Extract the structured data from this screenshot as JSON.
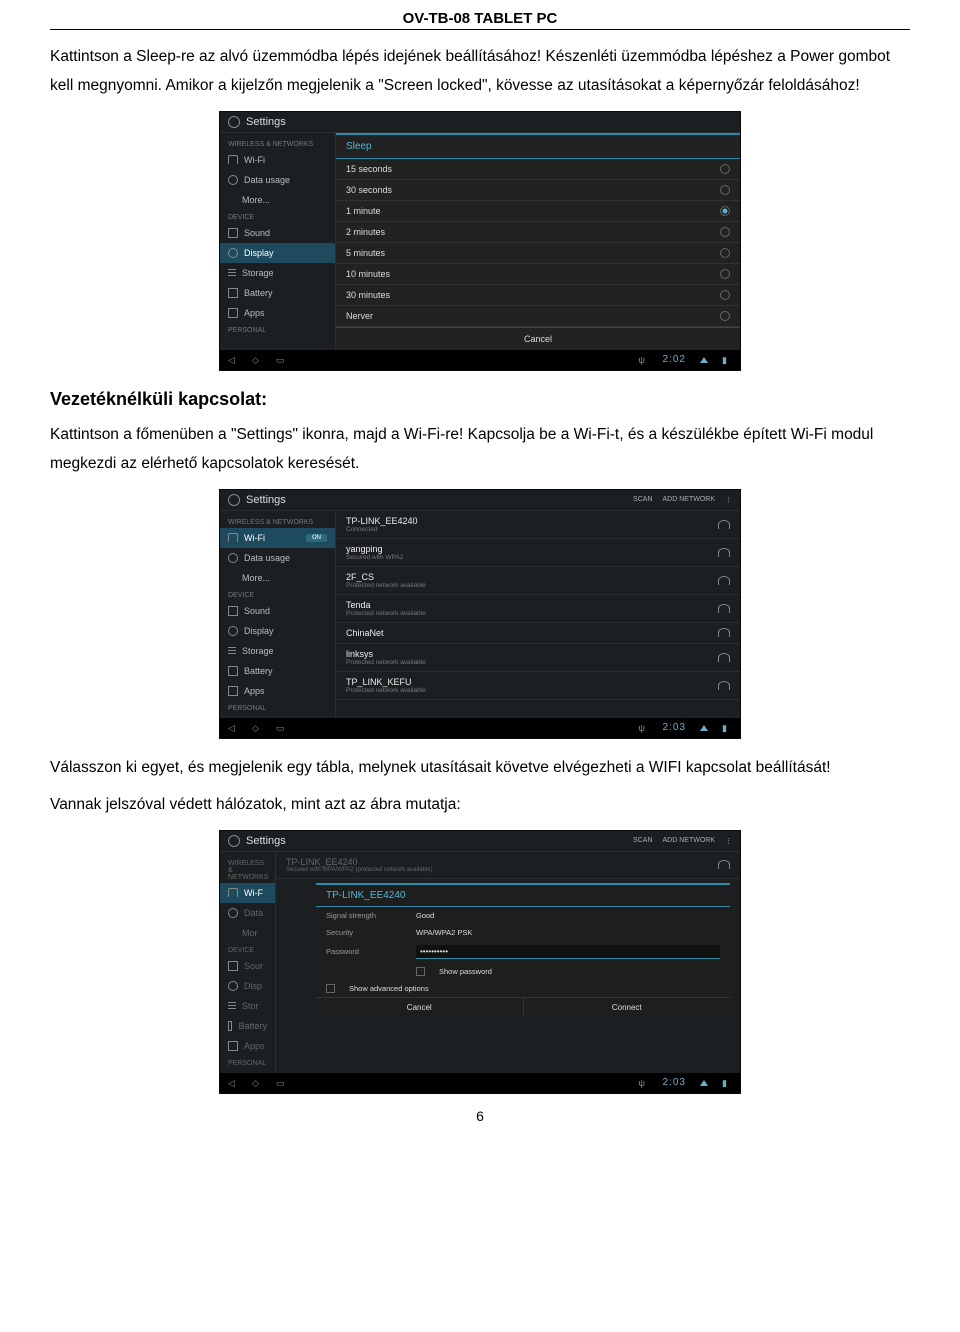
{
  "doc": {
    "header": "OV-TB-08 TABLET PC",
    "para1": "Kattintson a Sleep-re az alvó üzemmódba lépés idejének beállításához! Készenléti üzemmódba lépéshez a Power gombot kell megnyomni. Amikor a kijelzőn megjelenik a \"Screen locked\", kövesse az utasításokat a képernyőzár feloldásához!",
    "section_title": "Vezetéknélküli kapcsolat:",
    "para2": "Kattintson a főmenüben a \"Settings\" ikonra, majd a Wi-Fi-re! Kapcsolja be a Wi-Fi-t, és a készülékbe épített Wi-Fi modul megkezdi az elérhető kapcsolatok keresését.",
    "para3": "Válasszon ki egyet, és megjelenik egy tábla, melynek utasításait követve elvégezheti a WIFI kapcsolat beállítását!",
    "para4": "Vannak jelszóval védett hálózatok, mint azt az ábra mutatja:",
    "page_number": "6"
  },
  "sidebar": {
    "header_wireless": "WIRELESS & NETWORKS",
    "header_device": "DEVICE",
    "header_personal": "PERSONAL",
    "items": {
      "wifi": "Wi-Fi",
      "data": "Data usage",
      "more": "More...",
      "sound": "Sound",
      "display": "Display",
      "storage": "Storage",
      "battery": "Battery",
      "apps": "Apps"
    },
    "on_label": "ON"
  },
  "screenshot1": {
    "settings_title": "Settings",
    "dialog_title": "Sleep",
    "options": [
      "15 seconds",
      "30 seconds",
      "1 minute",
      "2 minutes",
      "5 minutes",
      "10 minutes",
      "30 minutes",
      "Nerver"
    ],
    "selected_index": 2,
    "cancel": "Cancel",
    "time": "2:02"
  },
  "screenshot2": {
    "settings_title": "Settings",
    "scan": "SCAN",
    "add": "ADD NETWORK",
    "networks": [
      {
        "name": "TP-LINK_EE4240",
        "sub": "Connected"
      },
      {
        "name": "yangping",
        "sub": "Secured with WPA2"
      },
      {
        "name": "2F_CS",
        "sub": "Protected network available"
      },
      {
        "name": "Tenda",
        "sub": "Protected network available"
      },
      {
        "name": "ChinaNet",
        "sub": ""
      },
      {
        "name": "linksys",
        "sub": "Protected network available"
      },
      {
        "name": "TP_LINK_KEFU",
        "sub": "Protected network available"
      }
    ],
    "time": "2:03"
  },
  "screenshot3": {
    "settings_title": "Settings",
    "scan": "SCAN",
    "add": "ADD NETWORK",
    "top_network": "TP-LINK_EE4240",
    "top_network_sub": "Secured with WPA/WPA2 (protected network available)",
    "dialog_title": "TP-LINK_EE4240",
    "signal_label": "Signal strength",
    "signal_value": "Good",
    "security_label": "Security",
    "security_value": "WPA/WPA2 PSK",
    "password_label": "Password",
    "password_value": "••••••••••",
    "show_password": "Show password",
    "show_advanced": "Show advanced options",
    "cancel": "Cancel",
    "connect": "Connect",
    "time": "2:03",
    "sidebar_short": {
      "wifi": "Wi-F",
      "data": "Data",
      "more": "Mor",
      "sound": "Sour",
      "display": "Disp",
      "storage": "Stor"
    }
  }
}
